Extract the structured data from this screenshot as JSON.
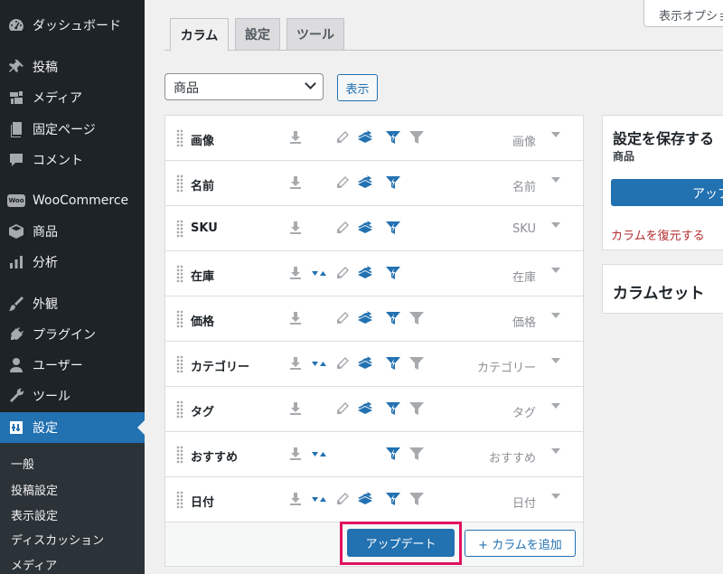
{
  "sidebar": {
    "items": [
      {
        "label": "ダッシュボード",
        "icon": "dashboard-icon"
      },
      {
        "label": "投稿",
        "icon": "pin-icon"
      },
      {
        "label": "メディア",
        "icon": "media-icon"
      },
      {
        "label": "固定ページ",
        "icon": "page-icon"
      },
      {
        "label": "コメント",
        "icon": "comment-icon"
      },
      {
        "label": "WooCommerce",
        "icon": "woo-icon",
        "badge": "Woo"
      },
      {
        "label": "商品",
        "icon": "box-icon"
      },
      {
        "label": "分析",
        "icon": "bar-chart-icon"
      },
      {
        "label": "外観",
        "icon": "brush-icon"
      },
      {
        "label": "プラグイン",
        "icon": "plug-icon"
      },
      {
        "label": "ユーザー",
        "icon": "user-icon"
      },
      {
        "label": "ツール",
        "icon": "wrench-icon"
      },
      {
        "label": "設定",
        "icon": "settings-icon"
      }
    ],
    "submenu": [
      "一般",
      "投稿設定",
      "表示設定",
      "ディスカッション",
      "メディア"
    ]
  },
  "screen_options": "表示オプション",
  "tabs": [
    {
      "label": "カラム"
    },
    {
      "label": "設定"
    },
    {
      "label": "ツール"
    }
  ],
  "type_select": {
    "value": "商品"
  },
  "show_button": "表示",
  "columns": [
    {
      "label": "画像",
      "type": "画像",
      "icons": [
        "download-icon",
        "edit-icon",
        "export-icon",
        "smart-filter-icon",
        "filter-icon"
      ]
    },
    {
      "label": "名前",
      "type": "名前",
      "icons": [
        "download-icon",
        "edit-icon",
        "export-icon",
        "smart-filter-icon"
      ]
    },
    {
      "label": "SKU",
      "type": "SKU",
      "icons": [
        "download-icon",
        "edit-icon",
        "export-icon",
        "smart-filter-icon"
      ]
    },
    {
      "label": "在庫",
      "type": "在庫",
      "icons": [
        "download-icon",
        "sort-icon",
        "edit-icon",
        "export-icon",
        "smart-filter-icon"
      ]
    },
    {
      "label": "価格",
      "type": "価格",
      "icons": [
        "download-icon",
        "edit-icon",
        "export-icon",
        "smart-filter-icon",
        "filter-icon"
      ]
    },
    {
      "label": "カテゴリー",
      "type": "カテゴリー",
      "icons": [
        "download-icon",
        "sort-icon",
        "edit-icon",
        "export-icon",
        "smart-filter-icon",
        "filter-icon"
      ]
    },
    {
      "label": "タグ",
      "type": "タグ",
      "icons": [
        "download-icon",
        "edit-icon",
        "export-icon",
        "smart-filter-icon",
        "filter-icon"
      ]
    },
    {
      "label": "おすすめ",
      "type": "おすすめ",
      "icons": [
        "download-icon",
        "sort-icon",
        "smart-filter-icon",
        "filter-icon"
      ]
    },
    {
      "label": "日付",
      "type": "日付",
      "icons": [
        "download-icon",
        "sort-icon",
        "edit-icon",
        "export-icon",
        "smart-filter-icon",
        "filter-icon"
      ]
    }
  ],
  "footer": {
    "update_button": "アップデート",
    "add_column_button": "+ カラムを追加"
  },
  "save_panel": {
    "title": "設定を保存する",
    "subtitle": "商品",
    "update_button": "アップデート",
    "restore_link": "カラムを復元する"
  },
  "column_set_panel": {
    "title": "カラムセット"
  },
  "colors": {
    "sidebar_bg": "#1d2327",
    "accent": "#2271b1",
    "highlight": "#e0115f",
    "danger": "#b32d2e"
  }
}
